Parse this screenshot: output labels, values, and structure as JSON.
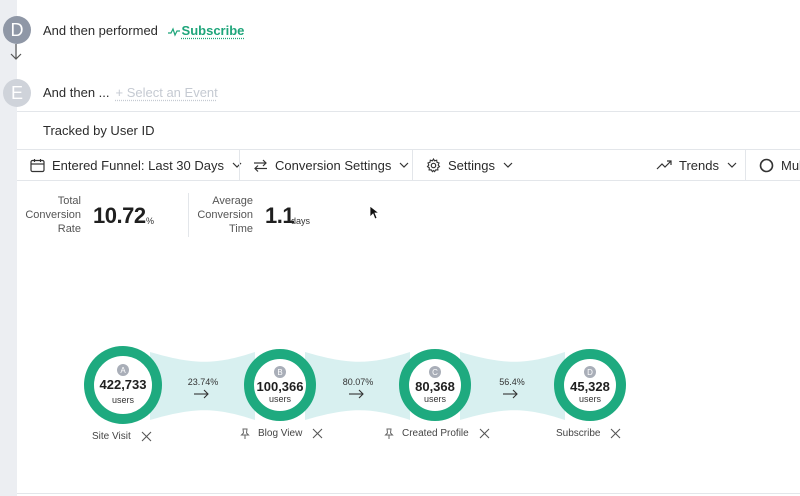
{
  "steps": {
    "d": {
      "letter": "D",
      "prefix": "And then performed",
      "event": "Subscribe"
    },
    "e": {
      "letter": "E",
      "prefix": "And then ...",
      "add_label": "+ Select an Event"
    }
  },
  "tracked_label": "Tracked by User ID",
  "toolbar": {
    "entered_funnel": "Entered Funnel: Last 30 Days",
    "conversion_settings": "Conversion Settings",
    "settings": "Settings",
    "trends": "Trends",
    "multi": "Mul"
  },
  "metrics": {
    "total_conversion": {
      "label_1": "Total",
      "label_2": "Conversion",
      "label_3": "Rate",
      "value": "10.72",
      "unit": "%"
    },
    "avg_conversion_time": {
      "label_1": "Average",
      "label_2": "Conversion",
      "label_3": "Time",
      "value": "1.1",
      "unit": "days"
    }
  },
  "funnel": {
    "nodes": [
      {
        "badge": "A",
        "count": "422,733",
        "unit": "users",
        "label": "Site Visit",
        "pinnable": false
      },
      {
        "badge": "B",
        "count": "100,366",
        "unit": "users",
        "label": "Blog View",
        "pinnable": true
      },
      {
        "badge": "C",
        "count": "80,368",
        "unit": "users",
        "label": "Created Profile",
        "pinnable": true
      },
      {
        "badge": "D",
        "count": "45,328",
        "unit": "users",
        "label": "Subscribe",
        "pinnable": false
      }
    ],
    "conversions": [
      "23.74%",
      "80.07%",
      "56.4%"
    ]
  },
  "colors": {
    "accent": "#1ea57a",
    "ring": "#1eaa7f",
    "flow": "#d8f0f0",
    "step_d": "#8f97a6",
    "step_e": "#cfd3da"
  }
}
